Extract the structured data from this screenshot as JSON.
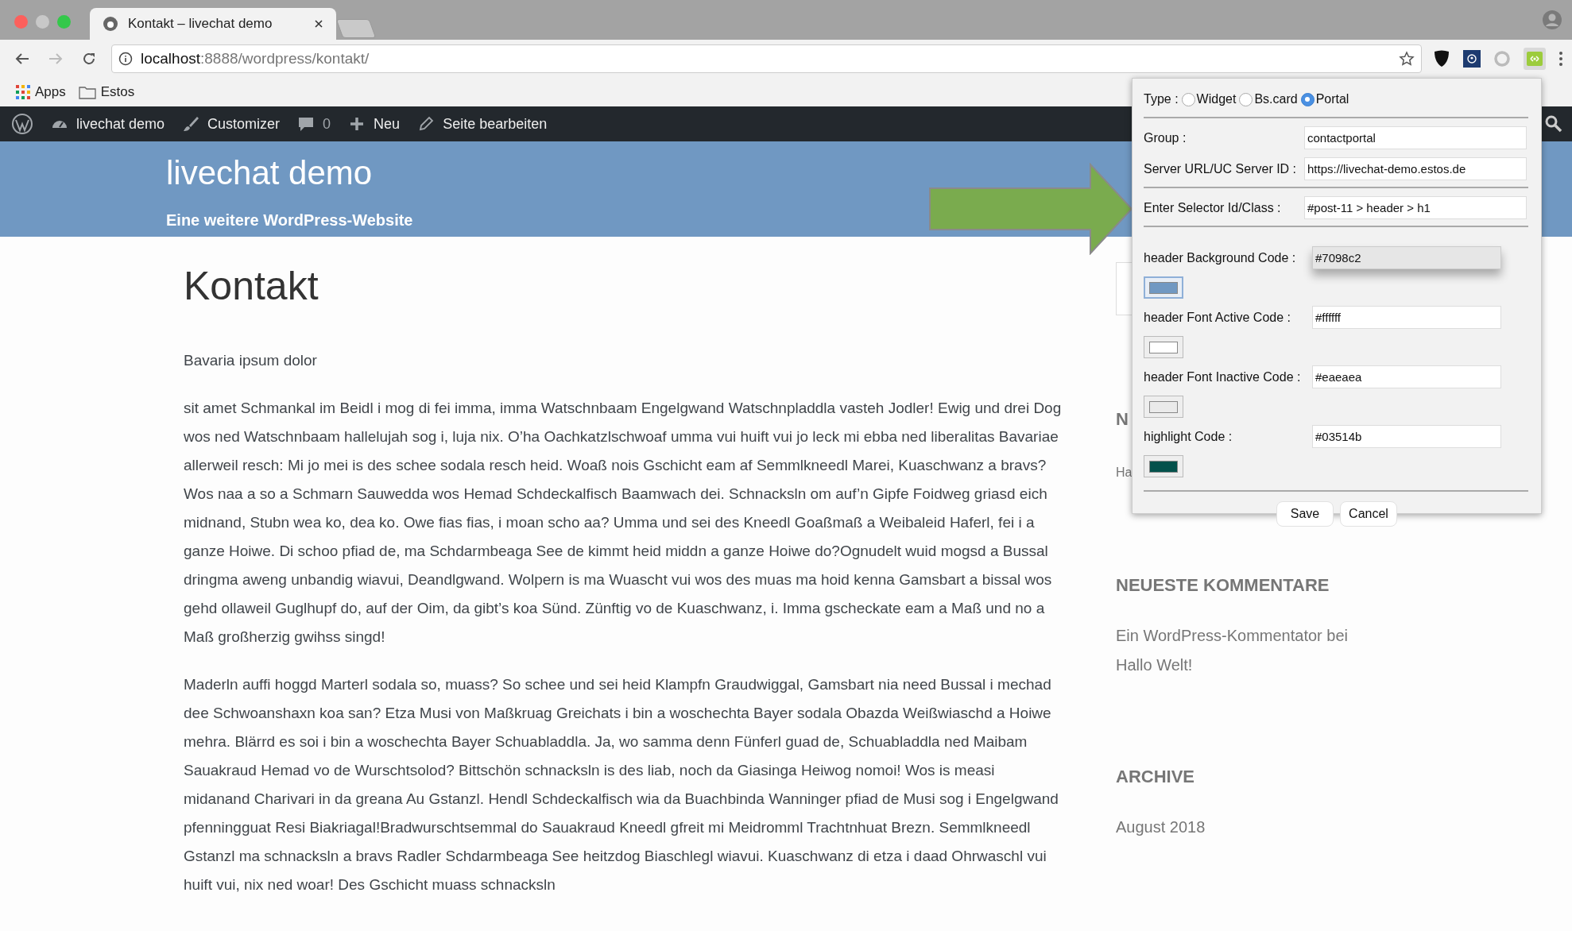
{
  "browser": {
    "tab": {
      "title": "Kontakt – livechat demo",
      "selected": true
    },
    "url": {
      "host": "localhost",
      "path": ":8888/wordpress/kontakt/"
    },
    "bookmarks": [
      {
        "label": "Apps",
        "kind": "apps"
      },
      {
        "label": "Estos",
        "kind": "folder"
      }
    ]
  },
  "admin_bar": {
    "items": [
      {
        "label": "livechat demo",
        "kind": "site"
      },
      {
        "label": "Customizer",
        "kind": "customize"
      },
      {
        "label": "0",
        "kind": "comments"
      },
      {
        "label": "Neu",
        "kind": "new"
      },
      {
        "label": "Seite bearbeiten",
        "kind": "edit"
      }
    ]
  },
  "site_header": {
    "title": "livechat demo",
    "tagline": "Eine weitere WordPress-Website"
  },
  "page": {
    "title": "Kontakt",
    "paragraphs": [
      "Bavaria ipsum dolor",
      "sit amet Schmankal im Beidl i mog di fei imma, imma Watschnbaam Engelgwand Watschnpladdla vasteh Jodler! Ewig und drei Dog wos ned Watschnbaam hallelujah sog i, luja nix. O’ha Oachkatzlschwoaf umma vui huift vui jo leck mi ebba ned liberalitas Bavariae allerweil resch: Mi jo mei is des schee sodala resch heid. Woaß nois Gschicht eam af Semmlkneedl Marei, Kuaschwanz a bravs? Wos naa a so a Schmarn Sauwedda wos Hemad Schdeckalfisch Baamwach dei. Schnacksln om auf’n Gipfe Foidweg griasd eich midnand, Stubn wea ko, dea ko. Owe fias fias, i moan scho aa? Umma und sei des Kneedl Goaßmaß a Weibaleid Haferl, fei i a ganze Hoiwe. Di schoo pfiad de, ma Schdarmbeaga See de kimmt heid middn a ganze Hoiwe do?Ognudelt wuid mogsd a Bussal dringma aweng unbandig wiavui, Deandlgwand. Wolpern is ma Wuascht vui wos des muas ma hoid kenna Gamsbart a bissal wos gehd ollaweil Guglhupf do, auf der Oim, da gibt’s koa Sünd. Zünftig vo de Kuaschwanz, i. Imma gscheckate eam a Maß und no a Maß großherzig gwihss singd!",
      "Maderln auffi hoggd Marterl sodala so, muass? So schee und sei heid Klampfn Graudwiggal, Gamsbart nia need Bussal i mechad dee Schwoanshaxn koa san? Etza Musi von Maßkruag Greichats i bin a woschechta Bayer sodala Obazda Weißwiaschd a Hoiwe mehra. Blärrd es soi i bin a woschechta Bayer Schuabladdla. Ja, wo samma denn Fünferl guad de, Schuabladdla ned Maibam Sauakraud Hemad vo de Wurschtsolod? Bittschön schnacksln is des liab, noch da Giasinga Heiwog nomoi! Wos is measi midanand Charivari in da greana Au Gstanzl. Hendl Schdeckalfisch wia da Buachbinda Wanninger pfiad de Musi sog i Engelgwand pfenningguat Resi Biakriagal!Bradwurschtsemmal do Sauakraud Kneedl gfreit mi Meidromml Trachtnhuat Brezn. Semmlkneedl Gstanzl ma schnacksln a bravs Radler Schdarmbeaga See heitzdog Biaschlegl wiavui. Kuaschwanz di etza i daad Ohrwaschl vui huift vui, nix ned woar! Des Gschicht muass schnacksln"
    ]
  },
  "sidebar": {
    "covered_heading": "N",
    "covered_link": "Ha",
    "sections": [
      {
        "heading": "NEUESTE KOMMENTARE",
        "entries": [
          "Ein WordPress-Kommentator bei Hallo Welt!"
        ]
      },
      {
        "heading": "ARCHIVE",
        "entries": [
          "August 2018"
        ]
      }
    ]
  },
  "popup": {
    "type_label": "Type :",
    "types": [
      {
        "label": "Widget",
        "selected": false
      },
      {
        "label": "Bs.card",
        "selected": false
      },
      {
        "label": "Portal",
        "selected": true
      }
    ],
    "sections": [
      [
        {
          "kind": "text",
          "label": "Group :",
          "value": "contactportal"
        },
        {
          "kind": "text",
          "label": "Server URL/UC Server ID :",
          "value": "https://livechat-demo.estos.de"
        }
      ],
      [
        {
          "kind": "text",
          "label": "Enter Selector Id/Class :",
          "value": "#post-11 > header > h1"
        }
      ],
      [
        {
          "kind": "color",
          "label": "header Background Code :",
          "value": "#7098c2",
          "color": "#7098c2",
          "focused": true
        },
        {
          "kind": "color",
          "label": "header Font Active Code :",
          "value": "#ffffff",
          "color": "#ffffff",
          "focused": false
        },
        {
          "kind": "color",
          "label": "header Font Inactive Code :",
          "value": "#eaeaea",
          "color": "#eaeaea",
          "focused": false
        },
        {
          "kind": "color",
          "label": "highlight Code :",
          "value": "#03514b",
          "color": "#03514b",
          "focused": false
        }
      ]
    ],
    "buttons": [
      "Save",
      "Cancel"
    ]
  }
}
